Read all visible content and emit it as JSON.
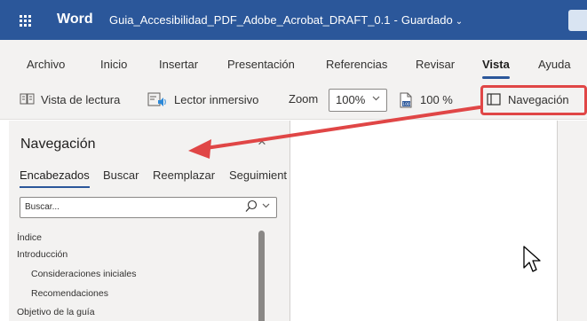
{
  "titlebar": {
    "app_name": "Word",
    "doc_name": "Guia_Accesibilidad_PDF_Adobe_Acrobat_DRAFT_0.1",
    "separator": "-",
    "save_status": "Guardado",
    "chevron": "⌄",
    "bg_color": "#2b579a"
  },
  "tabs": [
    "Archivo",
    "Inicio",
    "Insertar",
    "Presentación",
    "Referencias",
    "Revisar",
    "Vista",
    "Ayuda"
  ],
  "active_tab": "Vista",
  "toolbar": {
    "reading_view": "Vista de lectura",
    "immersive_reader": "Lector inmersivo",
    "zoom_label": "Zoom",
    "zoom_value": "100%",
    "zoom_100": "100 %",
    "navigation": "Navegación"
  },
  "nav_pane": {
    "title": "Navegación",
    "close": "×",
    "tabs": [
      "Encabezados",
      "Buscar",
      "Reemplazar",
      "Seguimient"
    ],
    "active_tab": "Encabezados",
    "search_placeholder": "Buscar...",
    "headings": [
      {
        "label": "Índice",
        "level": 1
      },
      {
        "label": "Introducción",
        "level": 1
      },
      {
        "label": "Consideraciones iniciales",
        "level": 2
      },
      {
        "label": "Recomendaciones",
        "level": 2
      },
      {
        "label": "Objetivo de la guía",
        "level": 1
      }
    ]
  },
  "annotation": {
    "highlight_color": "#e04646"
  },
  "icons": {
    "waffle": "app-launcher-icon",
    "reading_view": "book-icon",
    "immersive_reader": "immersive-reader-icon",
    "zoom_100": "zoom-100-icon",
    "navigation": "navigation-pane-icon",
    "search": "search-icon",
    "cursor": "mouse-pointer-icon"
  }
}
